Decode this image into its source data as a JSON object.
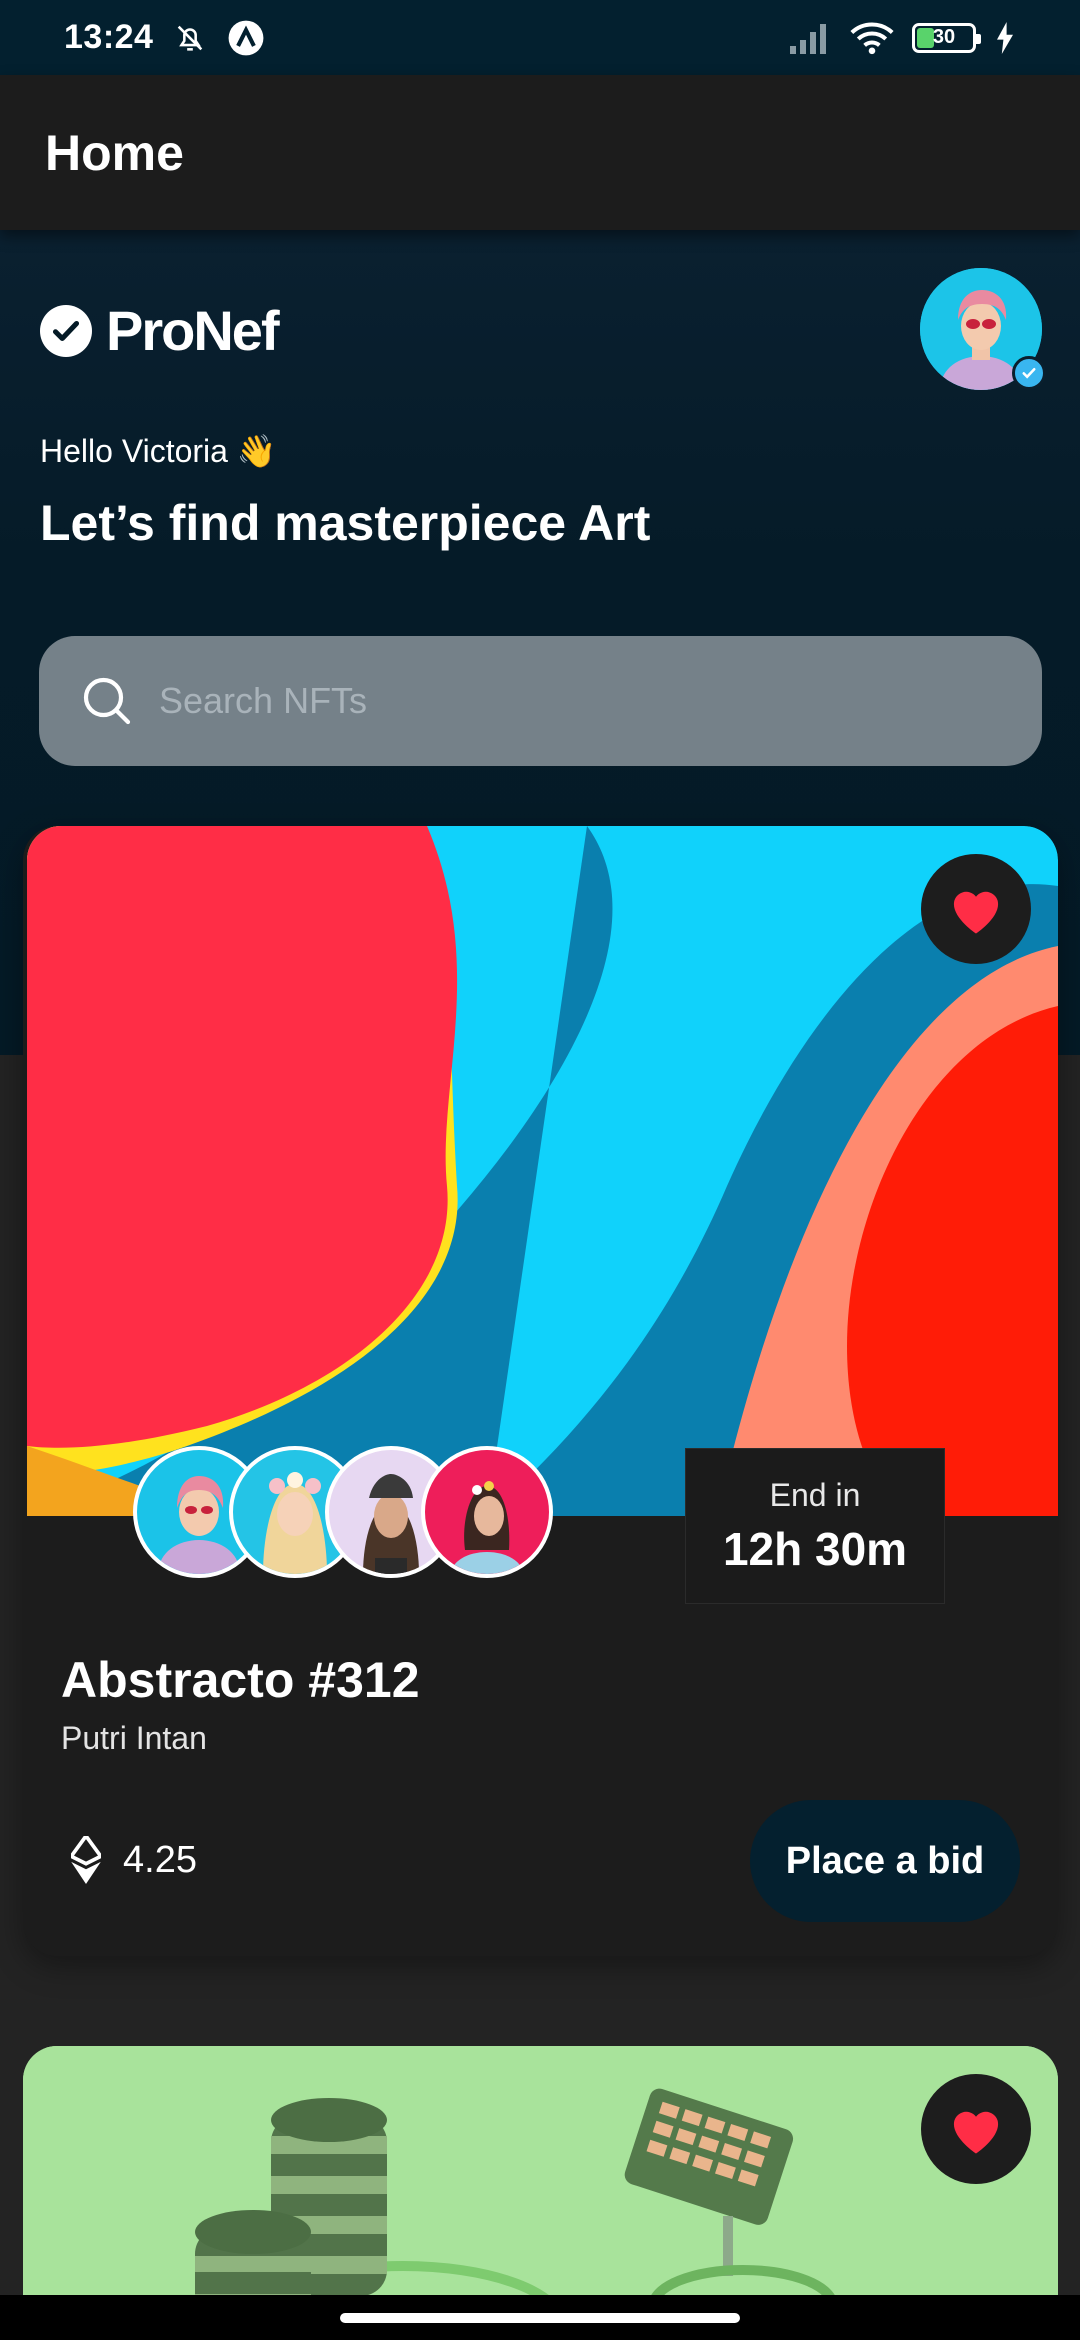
{
  "status_bar": {
    "time": "13:24",
    "battery": "30",
    "icons": [
      "bell-off-icon",
      "app-notification-icon",
      "signal-icon",
      "wifi-icon",
      "battery-icon",
      "charging-icon"
    ]
  },
  "app_bar": {
    "title": "Home"
  },
  "brand": {
    "name": "ProNef"
  },
  "greeting": "Hello Victoria 👋",
  "headline": "Let’s find masterpiece Art",
  "search": {
    "placeholder": "Search NFTs"
  },
  "featured": {
    "title": "Abstracto #312",
    "artist": "Putri Intan",
    "price": "4.25",
    "end_label": "End in",
    "end_value": "12h 30m",
    "bid_label": "Place a bid",
    "liked": true
  },
  "colors": {
    "background": "#041a26",
    "card": "#1c1c1c",
    "accent_red": "#ff2d46",
    "search_bg": "#758189",
    "button_bg": "#04202f"
  }
}
